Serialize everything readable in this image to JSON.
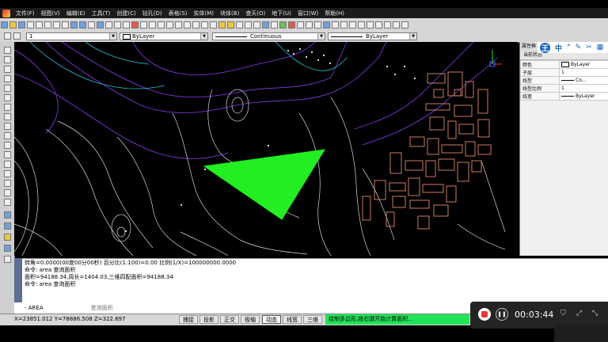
{
  "menu": {
    "items": [
      "文件(F)",
      "视图(V)",
      "编辑(E)",
      "工具(T)",
      "创建(C)",
      "钻孔(D)",
      "表格(S)",
      "实体(M)",
      "块体(B)",
      "查天(O)",
      "地下(U)",
      "窗口(W)",
      "帮助(H)"
    ]
  },
  "layer_bar": {
    "layer_value": "1",
    "color_value": "ByLayer",
    "linetype_value": "Continuous",
    "lineweight_value": "ByLayer"
  },
  "properties": {
    "header": "属性框",
    "section": "当前状态",
    "rows": [
      {
        "key": "颜色",
        "value": "ByLayer"
      },
      {
        "key": "子层",
        "value": "1"
      },
      {
        "key": "线型",
        "value": "Co..."
      },
      {
        "key": "线型比例",
        "value": "1"
      },
      {
        "key": "线宽",
        "value": "ByLayer"
      }
    ]
  },
  "overlay_icons": [
    "王",
    "中",
    "°",
    "✎",
    "✂",
    "▦"
  ],
  "command": {
    "lines": [
      "转角=0.0000(00度00分00秒)  百分比(1:100)=0.00  比例(1/X)=100000000.0000",
      "命令: area  查询面积",
      "面积=94188.34,周长=1404.03,三维四配面积=94188.34",
      "命令: area  查询面积"
    ],
    "prompt": "- AREA",
    "hint": "查询面积"
  },
  "status": {
    "coords": "X=23851.012 Y=78886.508 Z=322.697",
    "buttons": [
      {
        "label": "捕捉",
        "on": false
      },
      {
        "label": "投影",
        "on": false
      },
      {
        "label": "正交",
        "on": false
      },
      {
        "label": "极轴",
        "on": false
      },
      {
        "label": "动态",
        "on": true
      },
      {
        "label": "线宽",
        "on": false
      },
      {
        "label": "三维",
        "on": false
      }
    ],
    "message": "绘制多边形,按右键开始计算面积..."
  },
  "recorder": {
    "time": "00:03:44"
  },
  "colors": {
    "polygon": "#22ee22",
    "contour_white": "#d8d8d8",
    "contour_purple": "#8a3cf0",
    "buildings": "#e08a6a",
    "status_message_bg": "#22e35a"
  }
}
